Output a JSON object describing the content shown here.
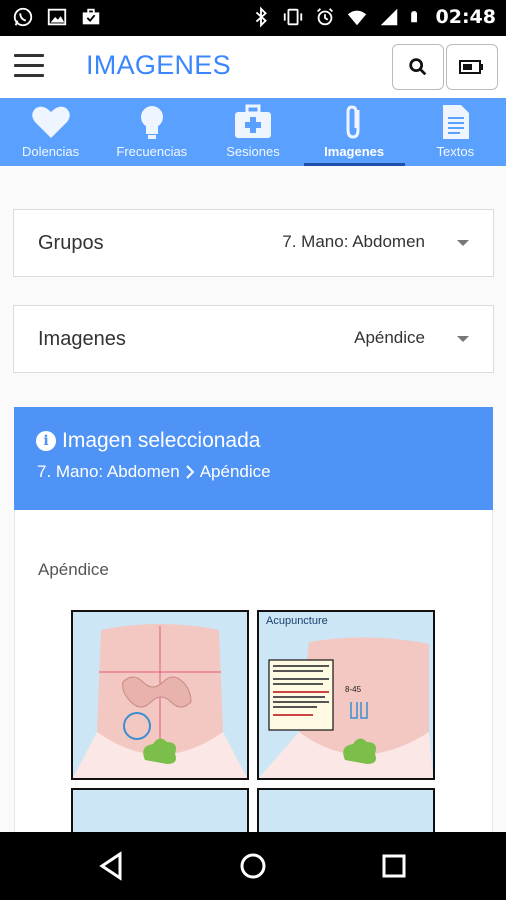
{
  "status_bar": {
    "time": "02:48",
    "left_icons": [
      "whatsapp-icon",
      "image-icon",
      "briefcase-icon"
    ],
    "right_icons": [
      "bluetooth-icon",
      "vibrate-icon",
      "alarm-icon",
      "wifi-icon",
      "signal-icon",
      "battery-icon"
    ]
  },
  "app_bar": {
    "title": "IMAGENES",
    "menu_icon": "hamburger-menu-icon",
    "search_icon": "search-icon",
    "battery_icon": "battery-icon"
  },
  "tabs": [
    {
      "label": "Dolencias",
      "icon": "heart-icon"
    },
    {
      "label": "Frecuencias",
      "icon": "lightbulb-icon"
    },
    {
      "label": "Sesiones",
      "icon": "first-aid-kit-icon"
    },
    {
      "label": "Imagenes",
      "icon": "paperclip-icon",
      "active": true
    },
    {
      "label": "Textos",
      "icon": "document-icon"
    }
  ],
  "grupos": {
    "label": "Grupos",
    "value": "7. Mano: Abdomen"
  },
  "imagenes": {
    "label": "Imagenes",
    "value": "Apéndice"
  },
  "info": {
    "title": "Imagen seleccionada",
    "crumb_group": "7. Mano: Abdomen",
    "crumb_item": "Apéndice"
  },
  "content": {
    "subtitle": "Apéndice",
    "tile2_caption": "Acupuncture",
    "tile2_number": "8-45"
  },
  "colors": {
    "accent": "#3a86ff",
    "tab_bar": "#5aa0ff",
    "info_panel": "#4e93f5"
  }
}
